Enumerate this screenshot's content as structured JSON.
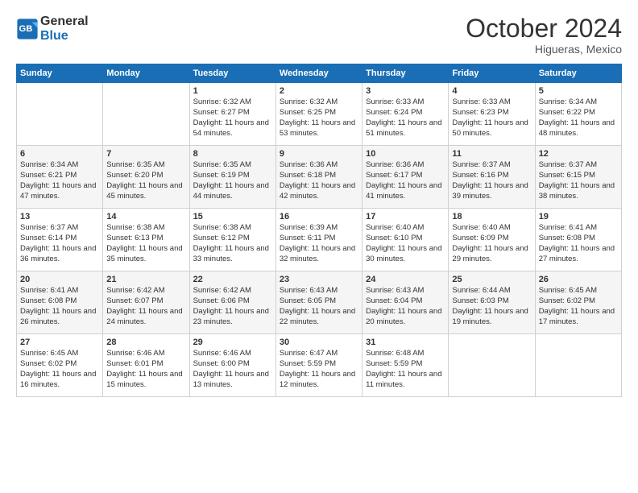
{
  "header": {
    "logo_line1": "General",
    "logo_line2": "Blue",
    "month": "October 2024",
    "location": "Higueras, Mexico"
  },
  "weekdays": [
    "Sunday",
    "Monday",
    "Tuesday",
    "Wednesday",
    "Thursday",
    "Friday",
    "Saturday"
  ],
  "weeks": [
    [
      {
        "day": "",
        "sunrise": "",
        "sunset": "",
        "daylight": ""
      },
      {
        "day": "",
        "sunrise": "",
        "sunset": "",
        "daylight": ""
      },
      {
        "day": "1",
        "sunrise": "Sunrise: 6:32 AM",
        "sunset": "Sunset: 6:27 PM",
        "daylight": "Daylight: 11 hours and 54 minutes."
      },
      {
        "day": "2",
        "sunrise": "Sunrise: 6:32 AM",
        "sunset": "Sunset: 6:25 PM",
        "daylight": "Daylight: 11 hours and 53 minutes."
      },
      {
        "day": "3",
        "sunrise": "Sunrise: 6:33 AM",
        "sunset": "Sunset: 6:24 PM",
        "daylight": "Daylight: 11 hours and 51 minutes."
      },
      {
        "day": "4",
        "sunrise": "Sunrise: 6:33 AM",
        "sunset": "Sunset: 6:23 PM",
        "daylight": "Daylight: 11 hours and 50 minutes."
      },
      {
        "day": "5",
        "sunrise": "Sunrise: 6:34 AM",
        "sunset": "Sunset: 6:22 PM",
        "daylight": "Daylight: 11 hours and 48 minutes."
      }
    ],
    [
      {
        "day": "6",
        "sunrise": "Sunrise: 6:34 AM",
        "sunset": "Sunset: 6:21 PM",
        "daylight": "Daylight: 11 hours and 47 minutes."
      },
      {
        "day": "7",
        "sunrise": "Sunrise: 6:35 AM",
        "sunset": "Sunset: 6:20 PM",
        "daylight": "Daylight: 11 hours and 45 minutes."
      },
      {
        "day": "8",
        "sunrise": "Sunrise: 6:35 AM",
        "sunset": "Sunset: 6:19 PM",
        "daylight": "Daylight: 11 hours and 44 minutes."
      },
      {
        "day": "9",
        "sunrise": "Sunrise: 6:36 AM",
        "sunset": "Sunset: 6:18 PM",
        "daylight": "Daylight: 11 hours and 42 minutes."
      },
      {
        "day": "10",
        "sunrise": "Sunrise: 6:36 AM",
        "sunset": "Sunset: 6:17 PM",
        "daylight": "Daylight: 11 hours and 41 minutes."
      },
      {
        "day": "11",
        "sunrise": "Sunrise: 6:37 AM",
        "sunset": "Sunset: 6:16 PM",
        "daylight": "Daylight: 11 hours and 39 minutes."
      },
      {
        "day": "12",
        "sunrise": "Sunrise: 6:37 AM",
        "sunset": "Sunset: 6:15 PM",
        "daylight": "Daylight: 11 hours and 38 minutes."
      }
    ],
    [
      {
        "day": "13",
        "sunrise": "Sunrise: 6:37 AM",
        "sunset": "Sunset: 6:14 PM",
        "daylight": "Daylight: 11 hours and 36 minutes."
      },
      {
        "day": "14",
        "sunrise": "Sunrise: 6:38 AM",
        "sunset": "Sunset: 6:13 PM",
        "daylight": "Daylight: 11 hours and 35 minutes."
      },
      {
        "day": "15",
        "sunrise": "Sunrise: 6:38 AM",
        "sunset": "Sunset: 6:12 PM",
        "daylight": "Daylight: 11 hours and 33 minutes."
      },
      {
        "day": "16",
        "sunrise": "Sunrise: 6:39 AM",
        "sunset": "Sunset: 6:11 PM",
        "daylight": "Daylight: 11 hours and 32 minutes."
      },
      {
        "day": "17",
        "sunrise": "Sunrise: 6:40 AM",
        "sunset": "Sunset: 6:10 PM",
        "daylight": "Daylight: 11 hours and 30 minutes."
      },
      {
        "day": "18",
        "sunrise": "Sunrise: 6:40 AM",
        "sunset": "Sunset: 6:09 PM",
        "daylight": "Daylight: 11 hours and 29 minutes."
      },
      {
        "day": "19",
        "sunrise": "Sunrise: 6:41 AM",
        "sunset": "Sunset: 6:08 PM",
        "daylight": "Daylight: 11 hours and 27 minutes."
      }
    ],
    [
      {
        "day": "20",
        "sunrise": "Sunrise: 6:41 AM",
        "sunset": "Sunset: 6:08 PM",
        "daylight": "Daylight: 11 hours and 26 minutes."
      },
      {
        "day": "21",
        "sunrise": "Sunrise: 6:42 AM",
        "sunset": "Sunset: 6:07 PM",
        "daylight": "Daylight: 11 hours and 24 minutes."
      },
      {
        "day": "22",
        "sunrise": "Sunrise: 6:42 AM",
        "sunset": "Sunset: 6:06 PM",
        "daylight": "Daylight: 11 hours and 23 minutes."
      },
      {
        "day": "23",
        "sunrise": "Sunrise: 6:43 AM",
        "sunset": "Sunset: 6:05 PM",
        "daylight": "Daylight: 11 hours and 22 minutes."
      },
      {
        "day": "24",
        "sunrise": "Sunrise: 6:43 AM",
        "sunset": "Sunset: 6:04 PM",
        "daylight": "Daylight: 11 hours and 20 minutes."
      },
      {
        "day": "25",
        "sunrise": "Sunrise: 6:44 AM",
        "sunset": "Sunset: 6:03 PM",
        "daylight": "Daylight: 11 hours and 19 minutes."
      },
      {
        "day": "26",
        "sunrise": "Sunrise: 6:45 AM",
        "sunset": "Sunset: 6:02 PM",
        "daylight": "Daylight: 11 hours and 17 minutes."
      }
    ],
    [
      {
        "day": "27",
        "sunrise": "Sunrise: 6:45 AM",
        "sunset": "Sunset: 6:02 PM",
        "daylight": "Daylight: 11 hours and 16 minutes."
      },
      {
        "day": "28",
        "sunrise": "Sunrise: 6:46 AM",
        "sunset": "Sunset: 6:01 PM",
        "daylight": "Daylight: 11 hours and 15 minutes."
      },
      {
        "day": "29",
        "sunrise": "Sunrise: 6:46 AM",
        "sunset": "Sunset: 6:00 PM",
        "daylight": "Daylight: 11 hours and 13 minutes."
      },
      {
        "day": "30",
        "sunrise": "Sunrise: 6:47 AM",
        "sunset": "Sunset: 5:59 PM",
        "daylight": "Daylight: 11 hours and 12 minutes."
      },
      {
        "day": "31",
        "sunrise": "Sunrise: 6:48 AM",
        "sunset": "Sunset: 5:59 PM",
        "daylight": "Daylight: 11 hours and 11 minutes."
      },
      {
        "day": "",
        "sunrise": "",
        "sunset": "",
        "daylight": ""
      },
      {
        "day": "",
        "sunrise": "",
        "sunset": "",
        "daylight": ""
      }
    ]
  ]
}
